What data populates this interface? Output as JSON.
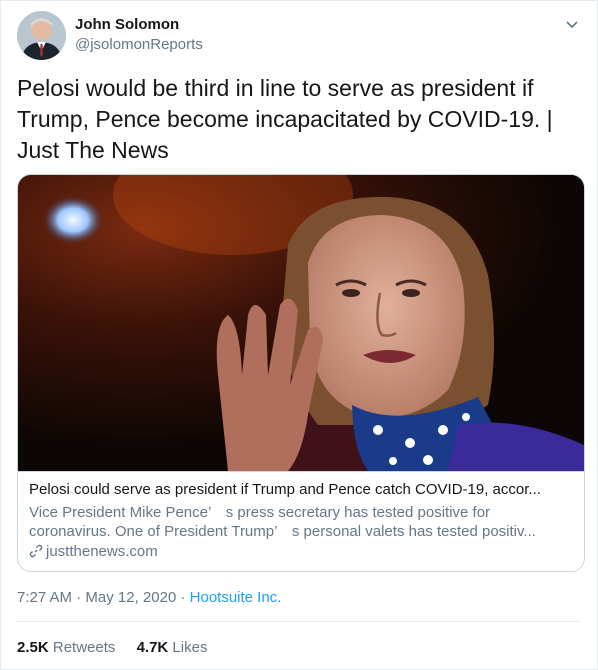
{
  "author": {
    "name": "John Solomon",
    "handle": "@jsolomonReports"
  },
  "tweet_text": "Pelosi would be third in line to serve as president if Trump, Pence become incapacitated by COVID-19. | Just The News",
  "card": {
    "title": "Pelosi could serve as president if Trump and Pence catch COVID-19, accor...",
    "description_line1": "Vice President Mike Pence’　s press secretary has tested positive for",
    "description_line2": "coronavirus.  One of President Trump’　s personal valets has tested positiv...",
    "domain": "justthenews.com",
    "link_icon": "link-icon"
  },
  "meta": {
    "time": "7:27 AM",
    "separator1": " · ",
    "date": "May 12, 2020",
    "separator2": " · ",
    "source": "Hootsuite Inc."
  },
  "stats": {
    "retweets_count": "2.5K",
    "retweets_label": "Retweets",
    "likes_count": "4.7K",
    "likes_label": "Likes"
  },
  "colors": {
    "accent": "#1da1f2",
    "secondary_text": "#657786"
  }
}
